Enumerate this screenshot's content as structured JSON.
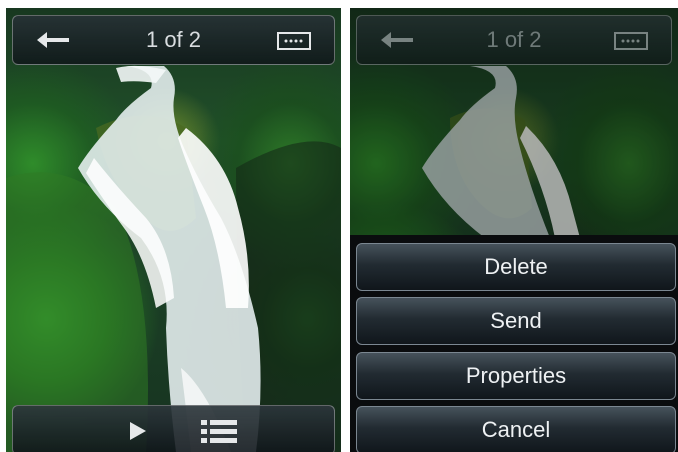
{
  "left_screen": {
    "top_bar": {
      "counter": "1 of 2",
      "back_icon": "back-arrow-icon",
      "fit_icon": "fit-screen-icon"
    },
    "bottom_bar": {
      "play_icon": "play-icon",
      "list_icon": "list-icon"
    }
  },
  "right_screen": {
    "top_bar": {
      "counter": "1 of 2",
      "back_icon": "back-arrow-icon",
      "fit_icon": "fit-screen-icon"
    },
    "menu": {
      "items": [
        {
          "label": "Delete"
        },
        {
          "label": "Send"
        },
        {
          "label": "Properties"
        },
        {
          "label": "Cancel"
        }
      ]
    }
  },
  "colors": {
    "bar_text": "#d9dde0",
    "menu_text": "#eef1f3",
    "menu_border": "#7b8791"
  }
}
